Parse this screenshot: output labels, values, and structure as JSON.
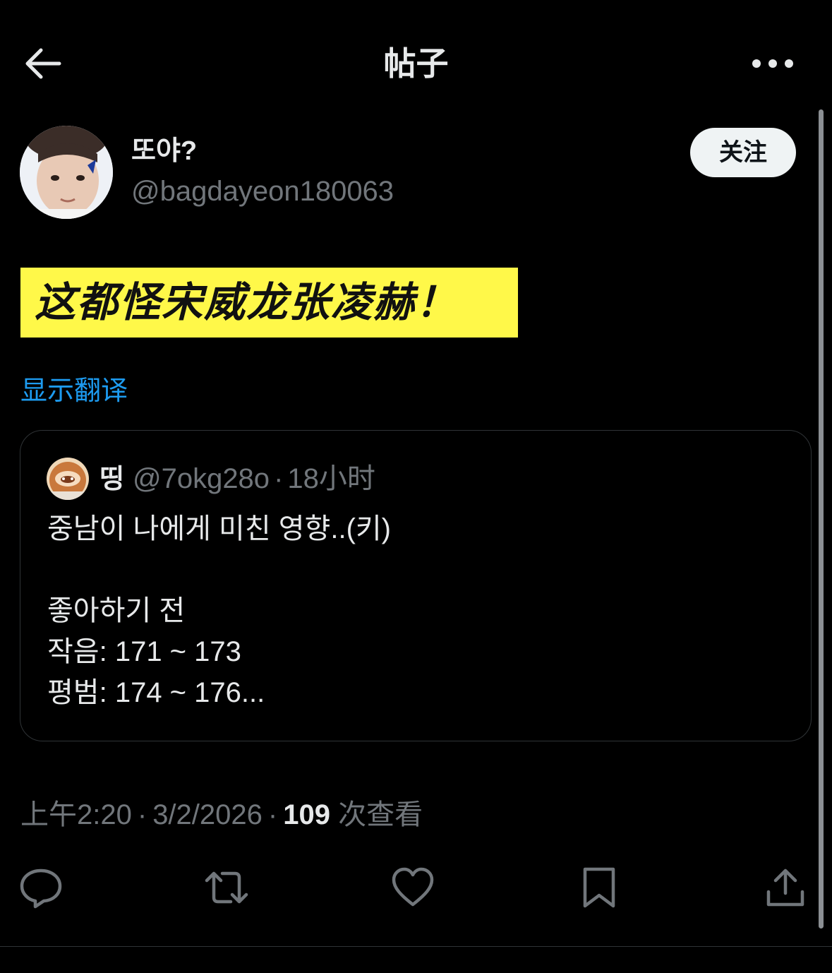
{
  "header": {
    "title": "帖子",
    "back_icon": "arrow-left-icon",
    "more_icon": "more-horizontal-icon"
  },
  "author": {
    "name": "또야?",
    "handle": "@bagdayeon180063",
    "follow_label": "关注"
  },
  "post": {
    "highlight_text": "这都怪宋威龙张凌赫！",
    "highlight_color": "#fff849",
    "translate_label": "显示翻译"
  },
  "quote": {
    "name": "띵",
    "handle": "@7okg28o",
    "separator": "·",
    "time": "18小时",
    "lines": [
      "중남이 나에게 미친 영향..(키)",
      "",
      "좋아하기 전",
      "작음: 171 ~ 173",
      "평범: 174 ~ 176..."
    ]
  },
  "meta": {
    "time": "上午2:20",
    "sep1": "·",
    "date": "3/2/2026",
    "sep2": "·",
    "views_count": "109",
    "views_label": "次查看"
  },
  "actions": {
    "reply_icon": "reply-icon",
    "repost_icon": "repost-icon",
    "like_icon": "heart-icon",
    "bookmark_icon": "bookmark-icon",
    "share_icon": "share-icon"
  },
  "colors": {
    "background": "#000000",
    "text": "#e7e9ea",
    "secondary": "#71767b",
    "link": "#1d9bf0",
    "border": "#2f3336"
  }
}
